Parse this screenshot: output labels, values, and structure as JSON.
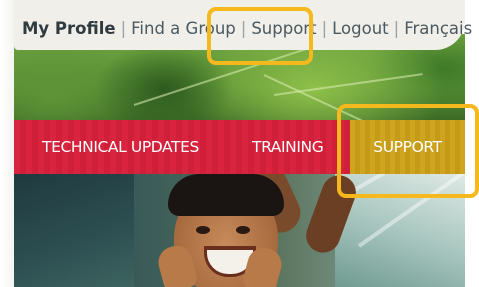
{
  "top_nav": {
    "links": [
      {
        "label": "My Profile",
        "active": true
      },
      {
        "label": "Find a Group",
        "active": false
      },
      {
        "label": "Support",
        "active": false
      },
      {
        "label": "Logout",
        "active": false
      },
      {
        "label": "Français",
        "active": false
      }
    ],
    "separator": "|"
  },
  "main_nav": {
    "items": [
      {
        "label": "TECHNICAL UPDATES"
      },
      {
        "label": "TRAINING"
      },
      {
        "label": "SUPPORT"
      }
    ]
  },
  "colors": {
    "nav_red": "#d8243f",
    "nav_support_gold": "#cfa51f",
    "highlight": "#f5b81d",
    "top_bar_bg": "#f0efe9",
    "top_link_text": "#4b5960"
  }
}
